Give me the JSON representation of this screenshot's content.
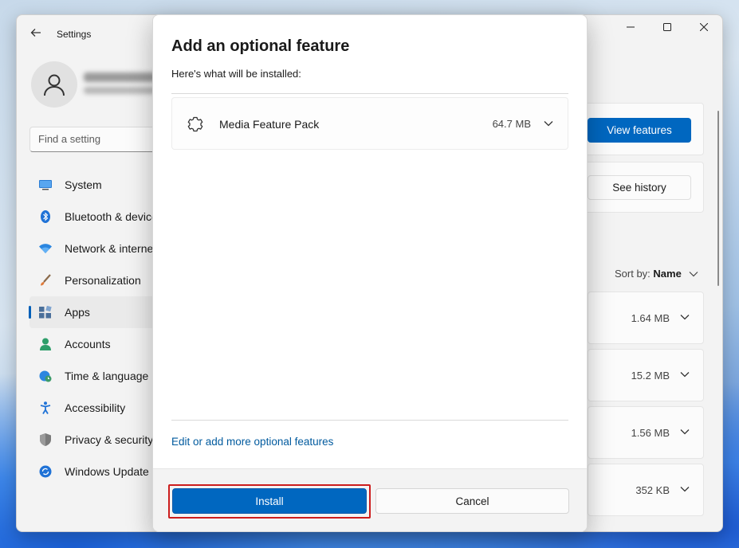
{
  "window": {
    "title": "Settings",
    "back_icon": "back-arrow-icon",
    "controls": [
      "minimize-icon",
      "maximize-icon",
      "close-icon"
    ]
  },
  "search": {
    "placeholder": "Find a setting"
  },
  "sidebar": {
    "items": [
      {
        "label": "System",
        "icon": "monitor-icon",
        "active": false
      },
      {
        "label": "Bluetooth & devices",
        "icon": "bluetooth-icon",
        "active": false
      },
      {
        "label": "Network & internet",
        "icon": "wifi-icon",
        "active": false
      },
      {
        "label": "Personalization",
        "icon": "brush-icon",
        "active": false
      },
      {
        "label": "Apps",
        "icon": "apps-icon",
        "active": true
      },
      {
        "label": "Accounts",
        "icon": "person-icon",
        "active": false
      },
      {
        "label": "Time & language",
        "icon": "globe-clock-icon",
        "active": false
      },
      {
        "label": "Accessibility",
        "icon": "accessibility-icon",
        "active": false
      },
      {
        "label": "Privacy & security",
        "icon": "shield-icon",
        "active": false
      },
      {
        "label": "Windows Update",
        "icon": "update-icon",
        "active": false
      }
    ]
  },
  "content": {
    "view_features_label": "View features",
    "see_history_label": "See history",
    "sort_prefix": "Sort by:",
    "sort_value": "Name",
    "rows": [
      {
        "size": "1.64 MB"
      },
      {
        "size": "15.2 MB"
      },
      {
        "size": "1.56 MB"
      },
      {
        "size": "352 KB"
      }
    ]
  },
  "dialog": {
    "title": "Add an optional feature",
    "subtitle": "Here's what will be installed:",
    "feature": {
      "name": "Media Feature Pack",
      "size": "64.7 MB",
      "icon": "puzzle-gear-icon"
    },
    "edit_link": "Edit or add more optional features",
    "install_label": "Install",
    "cancel_label": "Cancel"
  },
  "colors": {
    "accent": "#0067c0",
    "highlight_border": "#cc1d1d",
    "link": "#005a9e"
  }
}
